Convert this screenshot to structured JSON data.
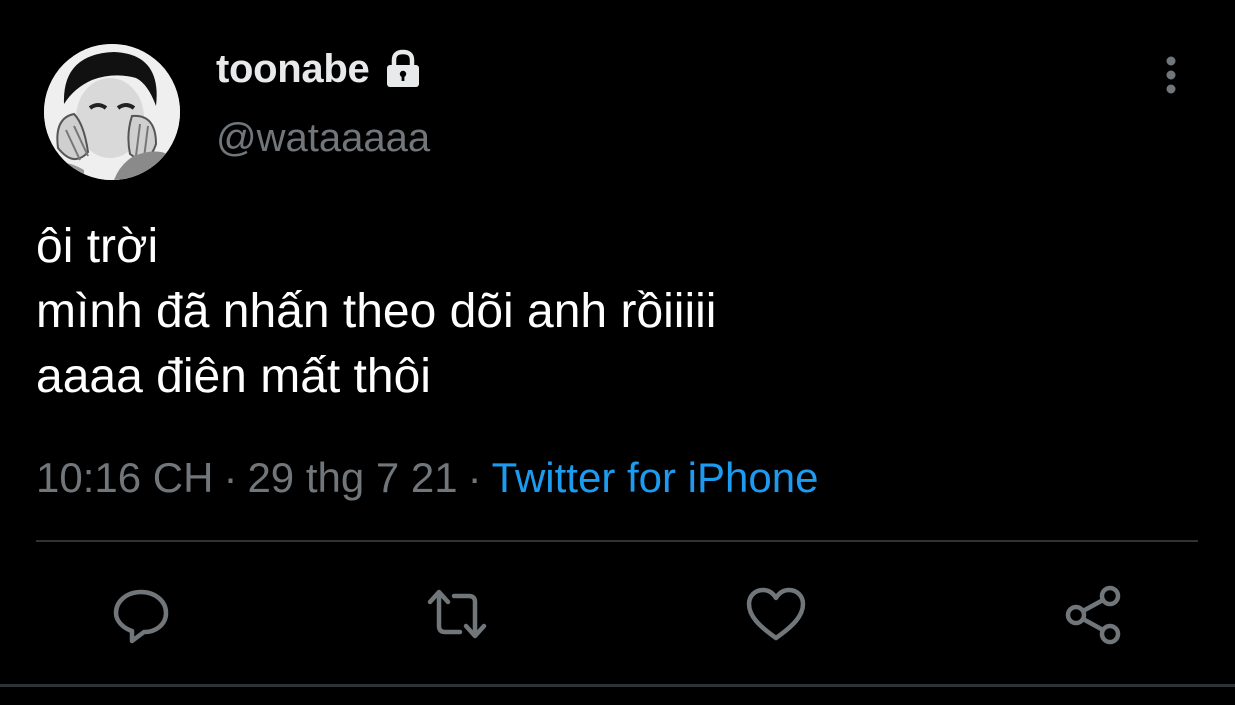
{
  "user": {
    "display_name": "toonabe",
    "handle": "@wataaaaa",
    "avatar_icon": "avatar-photo",
    "protected_icon": "lock-icon"
  },
  "tweet": {
    "lines": [
      "ôi trời",
      "mình đã nhấn theo dõi anh rồiiiii",
      "aaaa điên mất thôi"
    ],
    "time": "10:16 CH",
    "separator": "·",
    "date": "29 thg 7 21",
    "source": "Twitter for iPhone"
  },
  "actions": {
    "icons": [
      "reply-icon",
      "retweet-icon",
      "like-icon",
      "share-icon"
    ]
  },
  "menu": {
    "icon": "more-vertical-icon"
  },
  "colors": {
    "background": "#000000",
    "text": "#e7e9ea",
    "secondary_text": "#71767b",
    "link": "#1d9bf0",
    "divider": "#2f3336"
  }
}
